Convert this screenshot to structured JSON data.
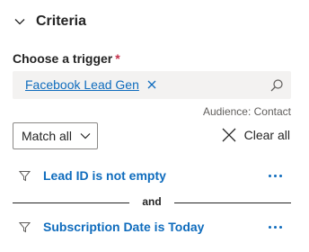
{
  "section": {
    "title": "Criteria",
    "icon": "chevron-down-icon"
  },
  "trigger": {
    "label": "Choose a trigger",
    "required_mark": "*",
    "selected_tag": "Facebook Lead Gen",
    "search_icon": "search-icon",
    "remove_icon": "close-icon"
  },
  "audience": "Audience: Contact",
  "match": {
    "label": "Match all",
    "icon": "chevron-down-icon"
  },
  "clear_all": {
    "label": "Clear all",
    "icon": "close-icon"
  },
  "conditions": [
    {
      "text": "Lead ID is not empty",
      "icon": "filter-icon",
      "more_icon": "more-horizontal-icon"
    },
    {
      "text": "Subscription Date is Today",
      "icon": "filter-icon",
      "more_icon": "more-horizontal-icon"
    }
  ],
  "operator": "and",
  "colors": {
    "link": "#0f6cbd",
    "required": "#c4314b",
    "input_bg": "#f3f2f1",
    "text": "#242424",
    "secondary_text": "#605e5c"
  }
}
